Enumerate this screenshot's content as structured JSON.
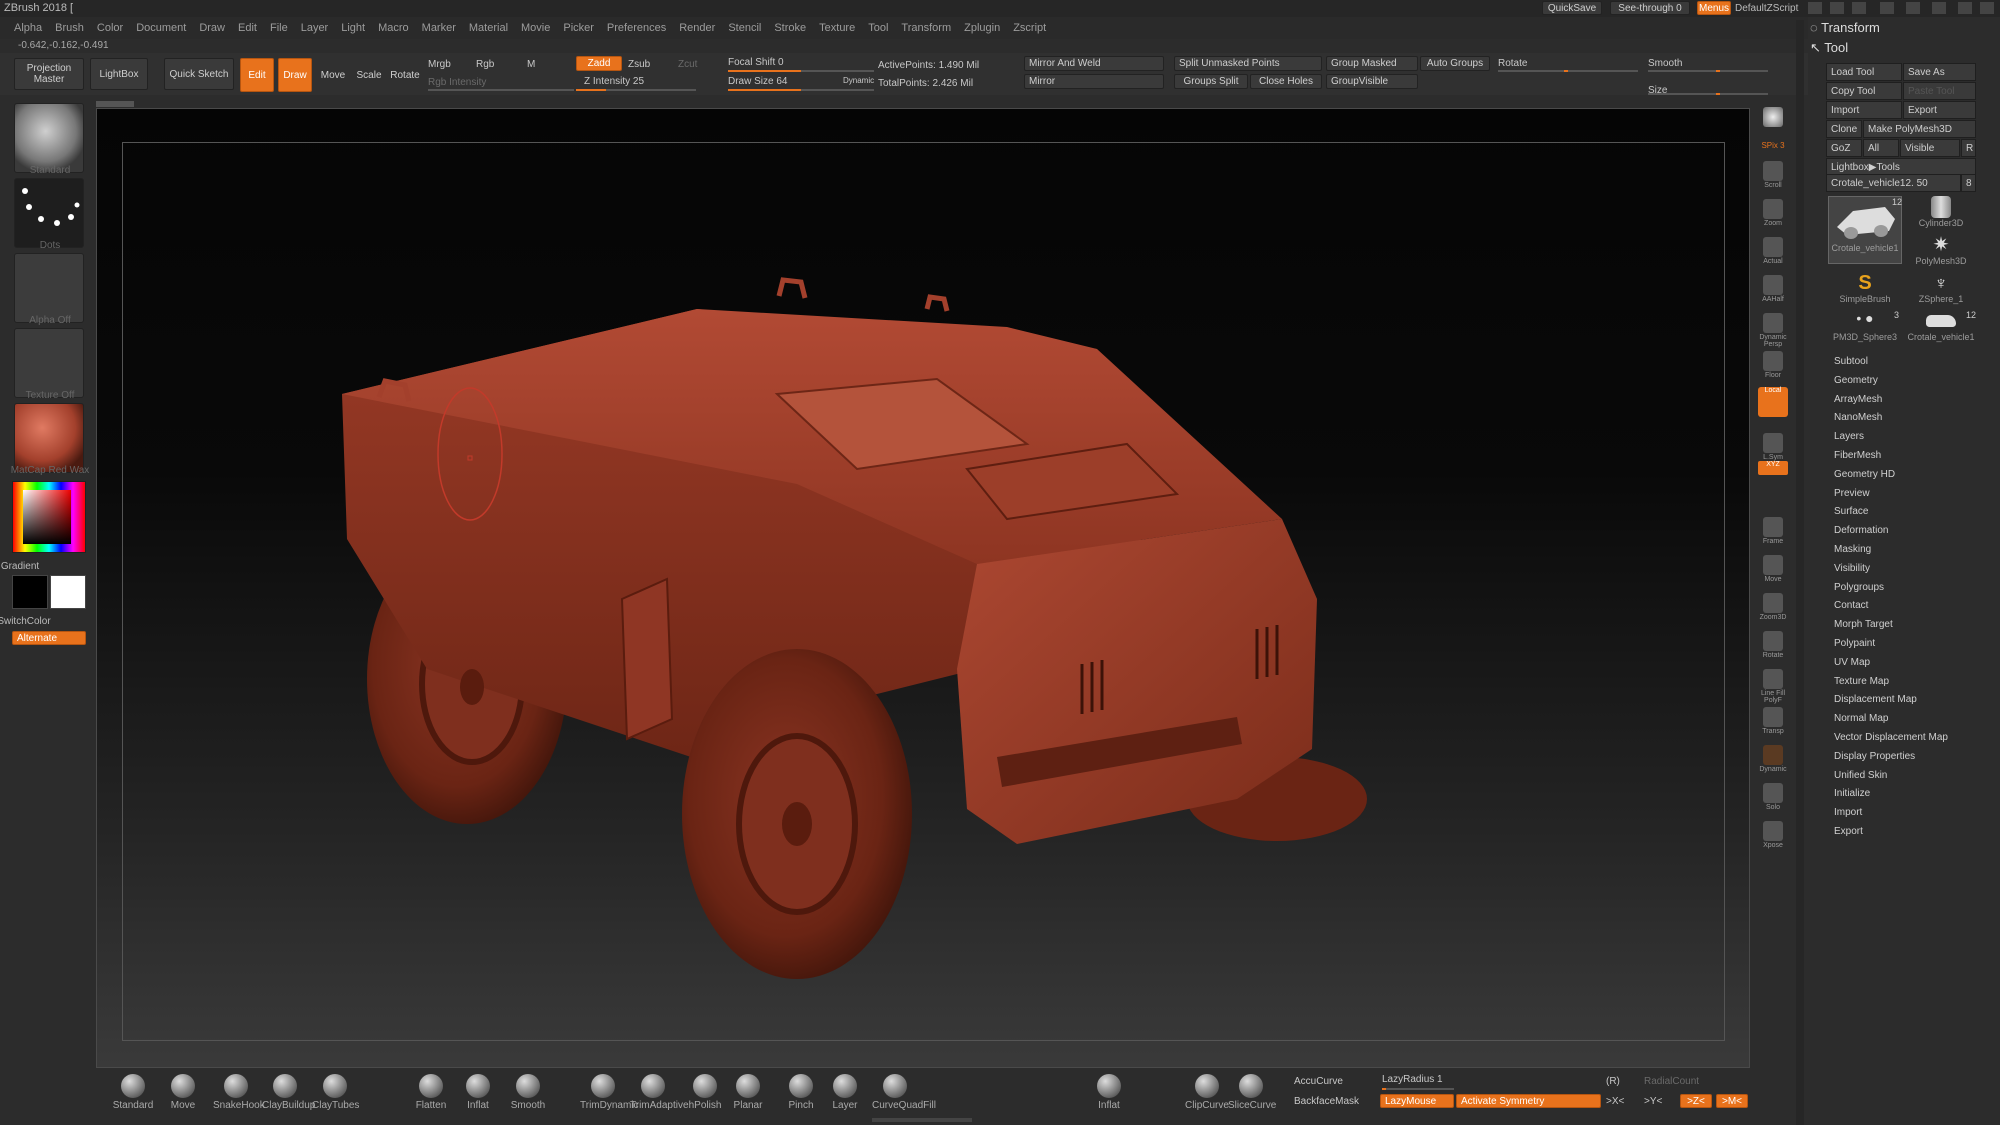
{
  "app": {
    "title": "ZBrush 2018 [",
    "coordinates": "-0.642,-0.162,-0.491"
  },
  "titlebar": {
    "quicksave": "QuickSave",
    "see_through": "See-through 0",
    "menus": "Menus",
    "default_zscript": "DefaultZScript"
  },
  "menu": [
    "Alpha",
    "Brush",
    "Color",
    "Document",
    "Draw",
    "Edit",
    "File",
    "Layer",
    "Light",
    "Macro",
    "Marker",
    "Material",
    "Movie",
    "Picker",
    "Preferences",
    "Render",
    "Stencil",
    "Stroke",
    "Texture",
    "Tool",
    "Transform",
    "Zplugin",
    "Zscript"
  ],
  "toolbar": {
    "projection_master": "Projection Master",
    "lightbox": "LightBox",
    "quick_sketch": "Quick Sketch",
    "edit": "Edit",
    "draw": "Draw",
    "move": "Move",
    "scale": "Scale",
    "rotate": "Rotate",
    "mrgb": "Mrgb",
    "rgb": "Rgb",
    "m": "M",
    "rgb_intensity": "Rgb Intensity",
    "zadd": "Zadd",
    "zsub": "Zsub",
    "zcut": "Zcut",
    "z_intensity": "Z Intensity 25",
    "focal_shift": "Focal Shift 0",
    "draw_size": "Draw Size 64",
    "dynamic": "Dynamic",
    "active_points": "ActivePoints: 1.490 Mil",
    "total_points": "TotalPoints: 2.426 Mil",
    "mirror_and_weld": "Mirror And Weld",
    "mirror": "Mirror",
    "split_unmasked": "Split Unmasked Points",
    "groups_split": "Groups Split",
    "close_holes": "Close Holes",
    "group_masked": "Group Masked",
    "group_visible": "GroupVisible",
    "auto_groups": "Auto Groups",
    "rotate_label": "Rotate",
    "smooth": "Smooth",
    "size": "Size",
    "z_intensity_value": 25,
    "focal_shift_value": 0,
    "draw_size_value": 64
  },
  "left_shelf": {
    "brush": "Standard",
    "stroke": "Dots",
    "alpha": "Alpha Off",
    "texture": "Texture Off",
    "material": "MatCap Red Wax",
    "gradient": "Gradient",
    "switch_color": "SwitchColor",
    "alternate": "Alternate"
  },
  "right_shelf": [
    "BPR",
    "SPix 3",
    "Scroll",
    "Zoom",
    "Actual",
    "AAHalf",
    "Dynamic Persp",
    "Floor",
    "Local",
    "L.Sym",
    "XYZ",
    "Frame",
    "Move",
    "Zoom3D",
    "Rotate",
    "Line Fill PolyF",
    "Transp",
    "Dynamic",
    "Solo",
    "Xpose"
  ],
  "tool_tray": {
    "transform": "Transform",
    "tool": "Tool",
    "load_tool": "Load Tool",
    "save_as": "Save As",
    "copy_tool": "Copy Tool",
    "paste_tool": "Paste Tool",
    "import": "Import",
    "export": "Export",
    "clone": "Clone",
    "make_polymesh": "Make PolyMesh3D",
    "goz": "GoZ",
    "all": "All",
    "visible": "Visible",
    "r": "R",
    "lightbox_tools": "Lightbox▶Tools",
    "current_tool": "Crotale_vehicle12. 50",
    "current_tool_count": "8",
    "thumbs": [
      {
        "label": "Crotale_vehicle1",
        "badge": "12"
      },
      {
        "label": "Cylinder3D",
        "badge": ""
      },
      {
        "label": "PolyMesh3D",
        "badge": ""
      },
      {
        "label": "SimpleBrush",
        "badge": ""
      },
      {
        "label": "ZSphere_1",
        "badge": ""
      },
      {
        "label": "PM3D_Sphere3",
        "badge": "3"
      },
      {
        "label": "Crotale_vehicle1",
        "badge": "12"
      }
    ],
    "subpalettes": [
      "Subtool",
      "Geometry",
      "ArrayMesh",
      "NanoMesh",
      "Layers",
      "FiberMesh",
      "Geometry HD",
      "Preview",
      "Surface",
      "Deformation",
      "Masking",
      "Visibility",
      "Polygroups",
      "Contact",
      "Morph Target",
      "Polypaint",
      "UV Map",
      "Texture Map",
      "Displacement Map",
      "Normal Map",
      "Vector Displacement Map",
      "Display Properties",
      "Unified Skin",
      "Initialize",
      "Import",
      "Export"
    ]
  },
  "bottom_bar": {
    "brushes": [
      "Standard",
      "Move",
      "SnakeHook",
      "ClayBuildup",
      "ClayTubes",
      "Flatten",
      "Inflat",
      "Smooth",
      "TrimDynamic",
      "TrimAdaptive",
      "hPolish",
      "Planar",
      "Pinch",
      "Layer",
      "CurveQuadFill",
      "Inflat",
      "ClipCurve",
      "SliceCurve"
    ],
    "accucurve": "AccuCurve",
    "backfacemask": "BackfaceMask",
    "lazyradius": "LazyRadius 1",
    "lazymouse": "LazyMouse",
    "activate_symmetry": "Activate Symmetry",
    "r_label": "(R)",
    "radialcount": "RadialCount",
    "x_axis": ">X<",
    "y_axis": ">Y<",
    "z_axis": ">Z<",
    "m_axis": ">M<"
  },
  "colors": {
    "accent": "#e8721c",
    "model": "#a3402c",
    "viewport_top": "#050505",
    "viewport_bottom": "#3a3a3a"
  }
}
